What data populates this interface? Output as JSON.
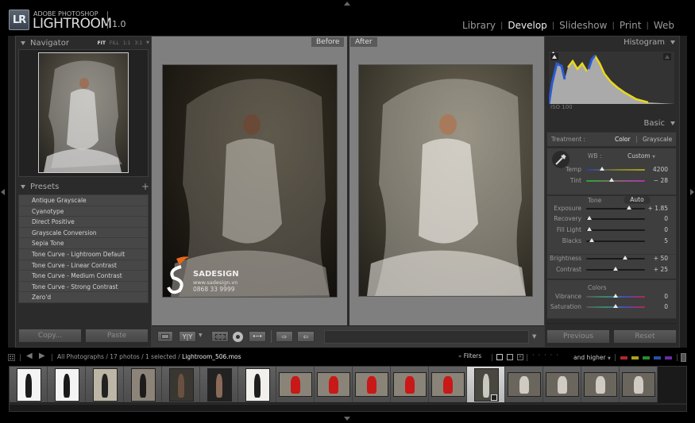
{
  "app": {
    "logo_mark": "LR",
    "brand_small": "ADOBE PHOTOSHOP",
    "brand_big": "LIGHTROOM",
    "version": "1.0"
  },
  "modules": [
    {
      "label": "Library",
      "active": false
    },
    {
      "label": "Develop",
      "active": true
    },
    {
      "label": "Slideshow",
      "active": false
    },
    {
      "label": "Print",
      "active": false
    },
    {
      "label": "Web",
      "active": false
    }
  ],
  "navigator": {
    "title": "Navigator",
    "zoom_options": [
      "FIT",
      "FILL",
      "1:1",
      "3:1"
    ],
    "zoom_selected": "FIT"
  },
  "presets": {
    "title": "Presets",
    "add_label": "+",
    "items": [
      "Antique Grayscale",
      "Cyanotype",
      "Direct Positive",
      "Grayscale Conversion",
      "Sepia Tone",
      "Tone Curve - Lightroom Default",
      "Tone Curve - Linear Contrast",
      "Tone Curve - Medium Contrast",
      "Tone Curve - Strong Contrast",
      "Zero'd"
    ]
  },
  "left_buttons": {
    "copy": "Copy...",
    "paste": "Paste"
  },
  "view": {
    "before_label": "Before",
    "after_label": "After",
    "watermark": {
      "brand": "SADESIGN",
      "url": "www.sadesign.vn",
      "phone": "0868 33 9999"
    }
  },
  "toolbar": {
    "before_after_mode": "Y|Y"
  },
  "histogram": {
    "title": "Histogram",
    "iso": "ISO 100"
  },
  "basic": {
    "title": "Basic",
    "treatment_label": "Treatment :",
    "treatment_options": [
      "Color",
      "Grayscale"
    ],
    "treatment_selected": "Color",
    "wb_label": "WB :",
    "wb_value": "Custom",
    "tone_label": "Tone",
    "auto_label": "Auto",
    "colors_label": "Colors",
    "sliders": [
      {
        "label": "Temp",
        "value": "4200",
        "pos": 0.27,
        "group": "wb",
        "track": "temp"
      },
      {
        "label": "Tint",
        "value": "− 28",
        "pos": 0.43,
        "group": "wb",
        "track": "tint"
      },
      {
        "label": "Exposure",
        "value": "+ 1.85",
        "pos": 0.73,
        "group": "tone",
        "track": "dark"
      },
      {
        "label": "Recovery",
        "value": "0",
        "pos": 0.05,
        "group": "tone",
        "track": "dark"
      },
      {
        "label": "Fill Light",
        "value": "0",
        "pos": 0.05,
        "group": "tone",
        "track": "dark"
      },
      {
        "label": "Blacks",
        "value": "5",
        "pos": 0.1,
        "group": "tone",
        "track": "dark"
      },
      {
        "label": "Brightness",
        "value": "+ 50",
        "pos": 0.66,
        "group": "tone2",
        "track": "dark"
      },
      {
        "label": "Contrast",
        "value": "+ 25",
        "pos": 0.5,
        "group": "tone2",
        "track": "dark"
      },
      {
        "label": "Vibrance",
        "value": "0",
        "pos": 0.5,
        "group": "colors",
        "track": "color"
      },
      {
        "label": "Saturation",
        "value": "0",
        "pos": 0.5,
        "group": "colors",
        "track": "color"
      }
    ]
  },
  "right_buttons": {
    "previous": "Previous",
    "reset": "Reset"
  },
  "filmstrip_bar": {
    "source": "All Photographs",
    "count": "17 photos",
    "selected": "1 selected",
    "filename": "Lightroom_506.mos",
    "filters_label": "Filters",
    "rating_label": "and higher",
    "color_labels": [
      "#b0282c",
      "#a9a21a",
      "#2c8a2e",
      "#2850a8",
      "#6a2aa8"
    ]
  },
  "filmstrip": {
    "selected_index": 12,
    "thumbs": [
      {
        "name": "model-black-outfit-1",
        "orientation": "portrait",
        "bg": "#f4f4f4",
        "fg": "#1a1a1a"
      },
      {
        "name": "model-black-outfit-2",
        "orientation": "portrait",
        "bg": "#f4f4f4",
        "fg": "#1a1a1a"
      },
      {
        "name": "model-black-outfit-3",
        "orientation": "portrait",
        "bg": "#bdb6a6",
        "fg": "#222"
      },
      {
        "name": "model-black-outfit-4",
        "orientation": "portrait",
        "bg": "#8c8478",
        "fg": "#1c1c1c"
      },
      {
        "name": "model-black-outfit-5",
        "orientation": "portrait",
        "bg": "#3a3632",
        "fg": "#6a5040"
      },
      {
        "name": "model-black-outfit-6",
        "orientation": "portrait",
        "bg": "#222",
        "fg": "#8a6a58"
      },
      {
        "name": "model-black-outfit-7",
        "orientation": "portrait",
        "bg": "#f2f0ec",
        "fg": "#1e1e1e"
      },
      {
        "name": "red-veil-1",
        "orientation": "landscape",
        "bg": "#8a8478",
        "fg": "#c81818"
      },
      {
        "name": "red-veil-2",
        "orientation": "landscape",
        "bg": "#8a8478",
        "fg": "#c81818"
      },
      {
        "name": "red-veil-3",
        "orientation": "landscape",
        "bg": "#8a8478",
        "fg": "#c81818"
      },
      {
        "name": "red-veil-4",
        "orientation": "landscape",
        "bg": "#8a8478",
        "fg": "#c81818"
      },
      {
        "name": "red-veil-5",
        "orientation": "landscape",
        "bg": "#8a8478",
        "fg": "#c81818"
      },
      {
        "name": "white-veil-selected",
        "orientation": "portrait",
        "bg": "#4a4740",
        "fg": "#c8c8c0"
      },
      {
        "name": "white-veil-2",
        "orientation": "landscape",
        "bg": "#6a665e",
        "fg": "#cfcbc2"
      },
      {
        "name": "white-veil-3",
        "orientation": "landscape",
        "bg": "#6a665e",
        "fg": "#cfcbc2"
      },
      {
        "name": "white-veil-4",
        "orientation": "landscape",
        "bg": "#6a665e",
        "fg": "#cfcbc2"
      },
      {
        "name": "white-veil-5",
        "orientation": "landscape",
        "bg": "#6a665e",
        "fg": "#cfcbc2"
      }
    ]
  }
}
